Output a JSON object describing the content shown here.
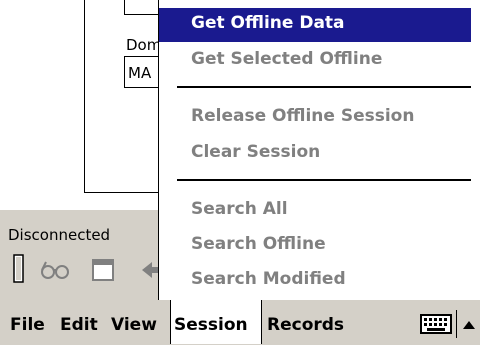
{
  "form": {
    "dom_label": "Dom",
    "dom_value": "MA"
  },
  "status": {
    "connection": "Disconnected"
  },
  "session_menu": {
    "items": [
      {
        "label": "Get Offline Data",
        "highlighted": true
      },
      {
        "label": "Get Selected Offline"
      },
      {
        "label": "Release Offline Session"
      },
      {
        "label": "Clear Session"
      },
      {
        "label": "Search All"
      },
      {
        "label": "Search Offline"
      },
      {
        "label": "Search Modified"
      }
    ]
  },
  "menubar": {
    "file": "File",
    "edit": "Edit",
    "view": "View",
    "session": "Session",
    "records": "Records"
  },
  "icons": {
    "toolbar": [
      "battery-icon",
      "glasses-icon",
      "window-icon",
      "back-arrow-icon"
    ],
    "keyboard": "keyboard-icon",
    "sip_toggle": "up-arrow-icon"
  },
  "colors": {
    "highlight": "#1a1a8f",
    "disabled_text": "#808080",
    "chrome": "#d4d0c8"
  }
}
